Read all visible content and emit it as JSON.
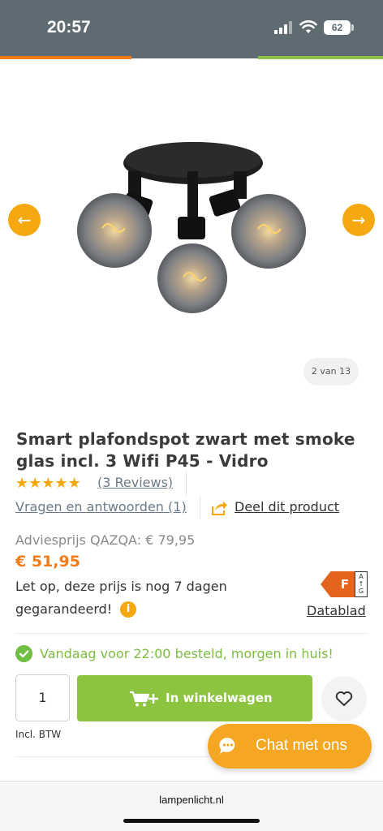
{
  "status_bar": {
    "time": "20:57",
    "battery": "62"
  },
  "gallery": {
    "prev_arrow": "←",
    "next_arrow": "→",
    "counter": "2 van 13"
  },
  "product": {
    "title": "Smart plafondspot zwart met smoke glas incl. 3 Wifi P45 - Vidro",
    "rating_stars": "★★★★★",
    "rating_value": 5,
    "reviews_link": "(3 Reviews)",
    "qa_link": "Vragen en antwoorden (1)",
    "share_link": "Deel dit product",
    "advice_price": "Adviesprijs QAZQA:  € 79,95",
    "price": "€ 51,95",
    "note_line1": "Let op, deze prijs is nog 7 dagen",
    "note_line2": "gegarandeerd!",
    "info_icon": "i",
    "energy_class": "F",
    "energy_scale": [
      "A",
      "↑",
      "G"
    ],
    "datasheet_link": "Datablad",
    "delivery": "Vandaag voor 22:00 besteld, morgen in huis!",
    "quantity": "1",
    "cart_button": "In winkelwagen",
    "vat_note": "Incl. BTW"
  },
  "chat": {
    "label": "Chat met ons"
  },
  "browser": {
    "url": "lampenlicht.nl"
  },
  "colors": {
    "accent_orange": "#f5a80f",
    "price_orange": "#f07d1a",
    "green": "#8cc43f",
    "status_bar": "#5f6b72"
  },
  "icons": {
    "signal": "cellular-signal-icon",
    "wifi": "wifi-icon",
    "battery": "battery-icon",
    "share": "share-icon",
    "check": "check-circle-icon",
    "cart": "cart-plus-icon",
    "favorite": "heart-icon",
    "chat": "chat-bubble-icon"
  }
}
